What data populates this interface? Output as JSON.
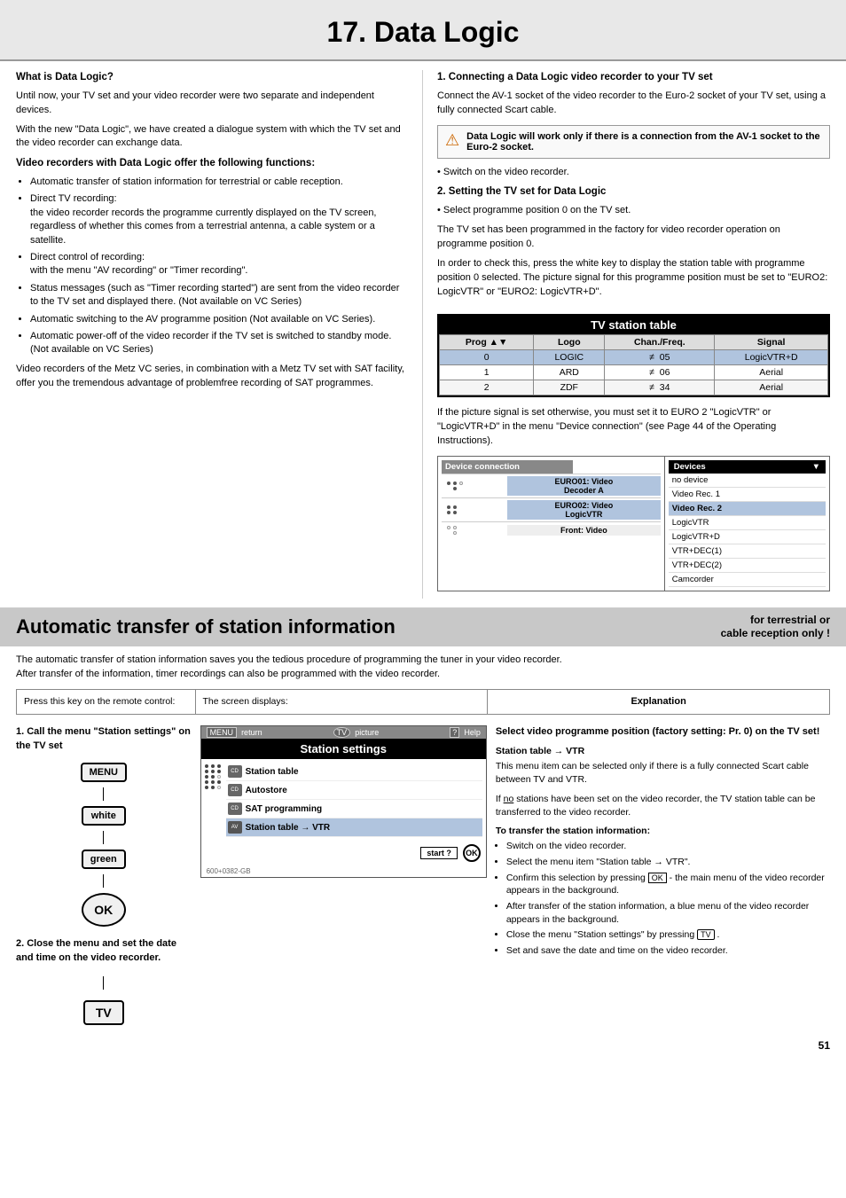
{
  "page": {
    "title": "17. Data Logic",
    "number": "51"
  },
  "left_col": {
    "what_is_heading": "What is Data Logic?",
    "what_is_p1": "Until now, your TV set and your video recorder were two separate and independent devices.",
    "what_is_p2": "With the new \"Data Logic\", we have created a dialogue system with which the TV set and the video recorder can exchange data.",
    "functions_heading": "Video recorders  with Data Logic offer the following functions:",
    "functions": [
      "Automatic transfer of station information for terrestrial or cable reception.",
      "Direct TV recording:\n            the video recorder records the programme currently displayed on the TV screen, regardless of whether this comes from a terrestrial antenna, a cable system or a satellite.",
      "Direct control of recording:\n            with the menu \"AV recording\" or \"Timer recording\".",
      "Status messages (such as \"Timer recording started\") are sent from the video recorder to the TV set and displayed there. (Not available on VC Series)",
      "Automatic switching to the AV programme position (Not available on VC Series).",
      "Automatic power-off of the video recorder if the TV set is switched to standby mode. (Not available on VC Series)"
    ],
    "closing_p": "Video recorders of the Metz VC series, in combination with a Metz TV set with SAT facility, offer you the tremendous advantage of problemfree recording of SAT programmes."
  },
  "right_col": {
    "section1_heading": "1. Connecting a Data Logic video recorder to your TV set",
    "section1_p": "Connect the AV-1 socket of the video recorder to the Euro-2 socket of your TV set, using a fully connected Scart cable.",
    "warning_text": "Data Logic will work only if there is a connection from the AV-1 socket to the Euro-2 socket.",
    "bullet1": "Switch on the video recorder.",
    "section2_heading": "2. Setting the TV set for Data Logic",
    "bullet2": "Select programme position 0 on the TV set.",
    "section2_p1": "The TV set has been programmed in the factory for video recorder operation on programme position 0.",
    "section2_p2": "In order to check this, press the white key to display the station table with programme position 0 selected. The picture signal for this programme position must be set to \"EURO2: LogicVTR\" or \"EURO2: LogicVTR+D\".",
    "tv_table": {
      "title": "TV station table",
      "headers": [
        "Prog ▲▼",
        "Logo",
        "Chan./Freq.",
        "Signal"
      ],
      "rows": [
        [
          "0",
          "LOGIC",
          "≠  05",
          "LogicVTR+D"
        ],
        [
          "1",
          "ARD",
          "≠  06",
          "Aerial"
        ],
        [
          "2",
          "ZDF",
          "≠  34",
          "Aerial"
        ]
      ]
    },
    "section2_p3": "If the picture signal is set otherwise, you must set it to EURO 2 \"LogicVTR\" or \"LogicVTR+D\" in the menu \"Device connection\" (see Page 44 of the Operating Instructions).",
    "device_conn": {
      "left_header": "Device connection",
      "right_header": "Devices",
      "rows": [
        {
          "label": "EURO01: Video Decoder A",
          "options": [
            "no device",
            "Video Rec. 1",
            "Video Rec. 2",
            "LogicVTR"
          ]
        },
        {
          "label": "EURO02: Video LogicVTR",
          "options": [
            "LogicVTR+D",
            "VTR+DEC(1)",
            "VTR+DEC(2)"
          ]
        },
        {
          "label": "Front: Video",
          "options": [
            "Camcorder"
          ]
        }
      ]
    }
  },
  "banner": {
    "title": "Automatic transfer of station information",
    "note_line1": "for terrestrial or",
    "note_line2": "cable reception only !"
  },
  "transfer_section": {
    "intro": "The automatic transfer of station information saves you the tedious procedure of programming the tuner in your video recorder.\nAfter transfer of the information, timer recordings can also be programmed with the video recorder.",
    "col1_header": "Press this key on the remote control:",
    "col2_header": "The screen displays:",
    "col3_header": "Explanation"
  },
  "bottom_left": {
    "heading": "1. Call the menu \"Station settings\" on the TV set",
    "buttons": [
      "MENU",
      "white",
      "green",
      "OK"
    ],
    "heading2": "2. Close the menu and set the date and time on the video recorder.",
    "tv_button": "TV"
  },
  "bottom_mid": {
    "topbar": {
      "return_icon": "MENU",
      "return_label": "return",
      "tv_label": "TV picture",
      "help_icon": "?",
      "help_label": "Help"
    },
    "screen_title": "Station settings",
    "menu_items": [
      {
        "icon": "CD",
        "label": "Station table",
        "selected": false
      },
      {
        "icon": "CD",
        "label": "Autostore",
        "selected": false
      },
      {
        "icon": "CD",
        "label": "SAT programming",
        "selected": false
      },
      {
        "icon": "AV",
        "label": "Station table → VTR",
        "selected": true
      }
    ],
    "start_label": "start ?",
    "ok_label": "OK",
    "footer": "600+0382-GB"
  },
  "bottom_right": {
    "expl_heading": "Select video programme position (factory setting: Pr. 0) on the TV set!",
    "subheading": "Station table → VTR",
    "p1": "This menu item can be selected only if there is a fully connected Scart cable between TV and VTR.",
    "p2_pre": "If ",
    "p2_underline": "no",
    "p2_post": " stations have been set on the video recorder, the TV station table can be transferred to the video recorder.",
    "transfer_heading": "To transfer the station information:",
    "bullets": [
      "Switch on the video recorder.",
      "Select the menu item \"Station table → VTR\".",
      "Confirm this selection by pressing  OK  - the main menu of the video recorder appears in the background.",
      "After transfer of the station information, a blue menu of the video recorder appears in the background.",
      "Close the menu \"Station settings\" by pressing  TV .",
      "Set and save the date and time on the video recorder."
    ]
  }
}
